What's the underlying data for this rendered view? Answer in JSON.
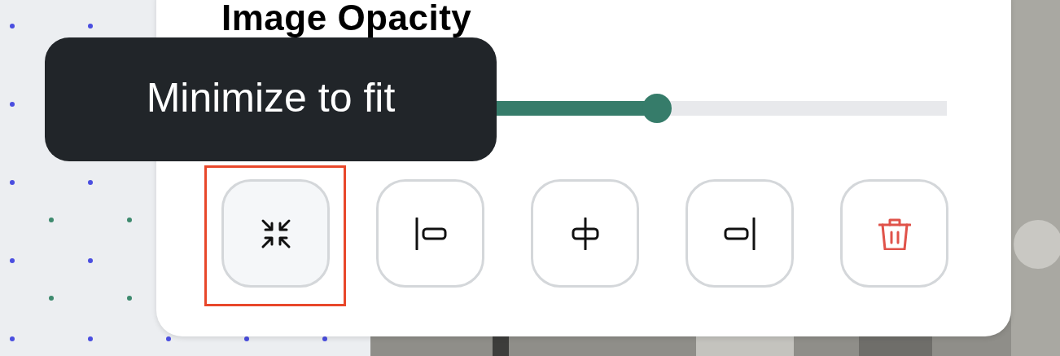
{
  "panel": {
    "title": "Image Opacity",
    "slider": {
      "level": 0.6
    },
    "buttons": [
      {
        "kind": "minimize",
        "highlighted": true
      },
      {
        "kind": "align-left",
        "highlighted": false
      },
      {
        "kind": "align-center",
        "highlighted": false
      },
      {
        "kind": "align-right",
        "highlighted": false
      },
      {
        "kind": "delete",
        "highlighted": false
      }
    ]
  },
  "tooltip": {
    "text": "Minimize to fit"
  }
}
